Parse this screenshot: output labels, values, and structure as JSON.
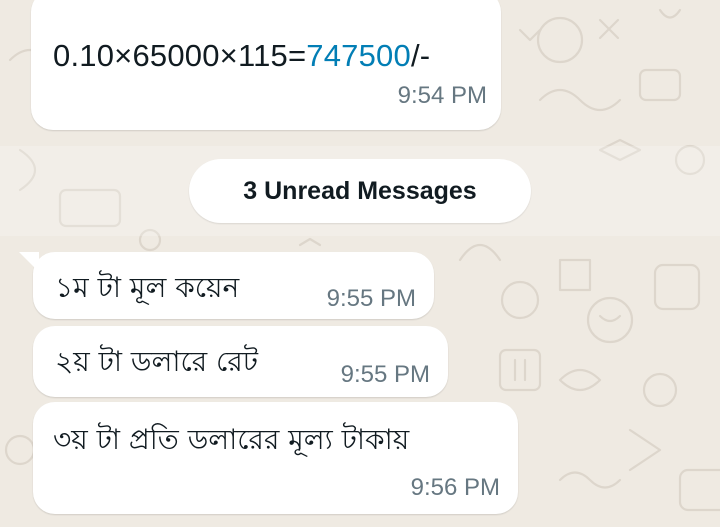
{
  "chat": {
    "wallpaper_color": "#efeae2",
    "bubble_color": "#ffffff",
    "text_color": "#111b21",
    "time_color": "#667781",
    "link_color": "#027eb5",
    "unread_banner": "3 Unread Messages",
    "messages": [
      {
        "text_prefix": "0.10×65000×115=",
        "text_number": "747500",
        "text_suffix": "/-",
        "time": "9:54 PM"
      },
      {
        "text": "১ম টা মূল কয়েন",
        "time": "9:55 PM"
      },
      {
        "text": "২য় টা ডলারে রেট",
        "time": "9:55 PM"
      },
      {
        "text": "৩য় টা প্রতি ডলারের মূল্য টাকায়",
        "time": "9:56 PM"
      }
    ]
  }
}
